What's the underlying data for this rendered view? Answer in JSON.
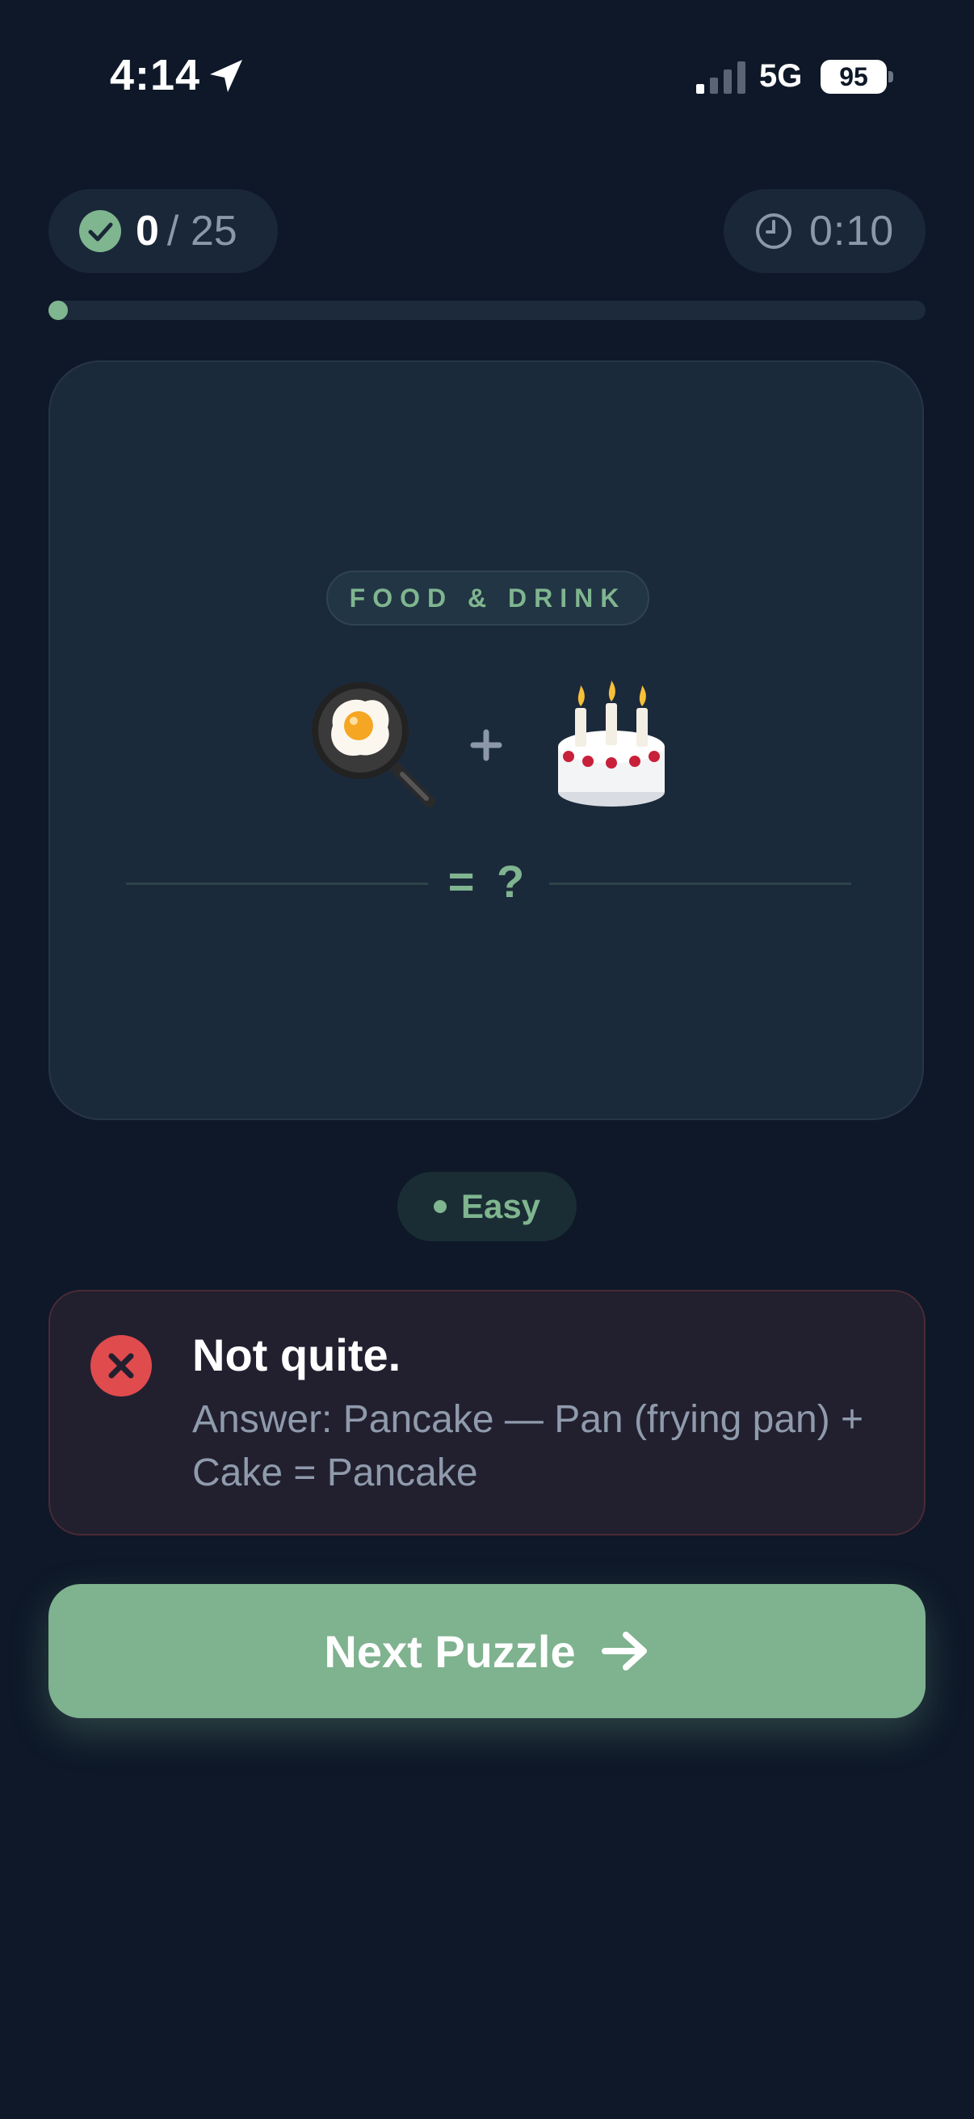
{
  "status_bar": {
    "time": "4:14",
    "network": "5G",
    "battery": "95",
    "icons": [
      "location-arrow-icon",
      "signal-icon"
    ]
  },
  "score": {
    "correct": "0",
    "total": "/ 25",
    "icon": "check-circle-icon"
  },
  "timer": {
    "value": "0:10",
    "icon": "clock-icon"
  },
  "progress": {
    "fraction": 0.02,
    "color": "#7fb58f"
  },
  "puzzle": {
    "category": "FOOD & DRINK",
    "emoji_1": "frying-pan-egg-icon",
    "operator": "+",
    "emoji_2": "birthday-cake-icon",
    "result": "= ?"
  },
  "difficulty": {
    "label": "Easy"
  },
  "feedback": {
    "icon": "x-circle-icon",
    "title": "Not quite.",
    "answer": "Answer: Pancake — Pan (frying pan) + Cake = Pancake"
  },
  "next_button": {
    "label": "Next Puzzle",
    "icon": "arrow-right-icon"
  },
  "colors": {
    "background": "#0e1828",
    "card": "#1b2a3b",
    "accent": "#7fb58f",
    "error": "#e04b4e",
    "muted_text": "#8f9bac"
  }
}
